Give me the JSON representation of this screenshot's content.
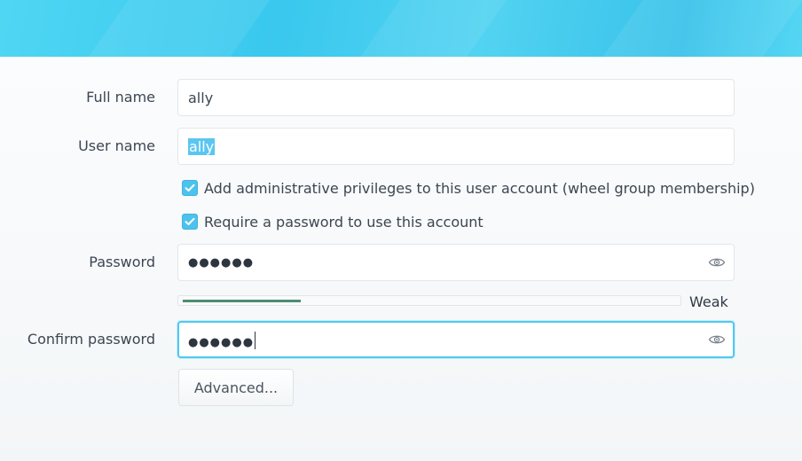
{
  "form": {
    "full_name": {
      "label": "Full name",
      "value": "ally"
    },
    "user_name": {
      "label": "User name",
      "value": "ally"
    },
    "admin_checkbox": {
      "label": "Add administrative privileges to this user account (wheel group membership)",
      "checked": true
    },
    "require_password_checkbox": {
      "label": "Require a password to use this account",
      "checked": true
    },
    "password": {
      "label": "Password",
      "value": "●●●●●●"
    },
    "password_strength": {
      "label": "Weak",
      "level": 0.24,
      "color": "#4f8d70"
    },
    "confirm_password": {
      "label": "Confirm password",
      "value": "●●●●●●"
    },
    "advanced_button": {
      "label": "Advanced..."
    }
  },
  "icons": {
    "checkbox": "check-icon",
    "reveal": "eye-icon"
  },
  "colors": {
    "accent": "#4dc2ec",
    "banner": "#3fc7ef",
    "focus_border": "#4fc9ef"
  }
}
